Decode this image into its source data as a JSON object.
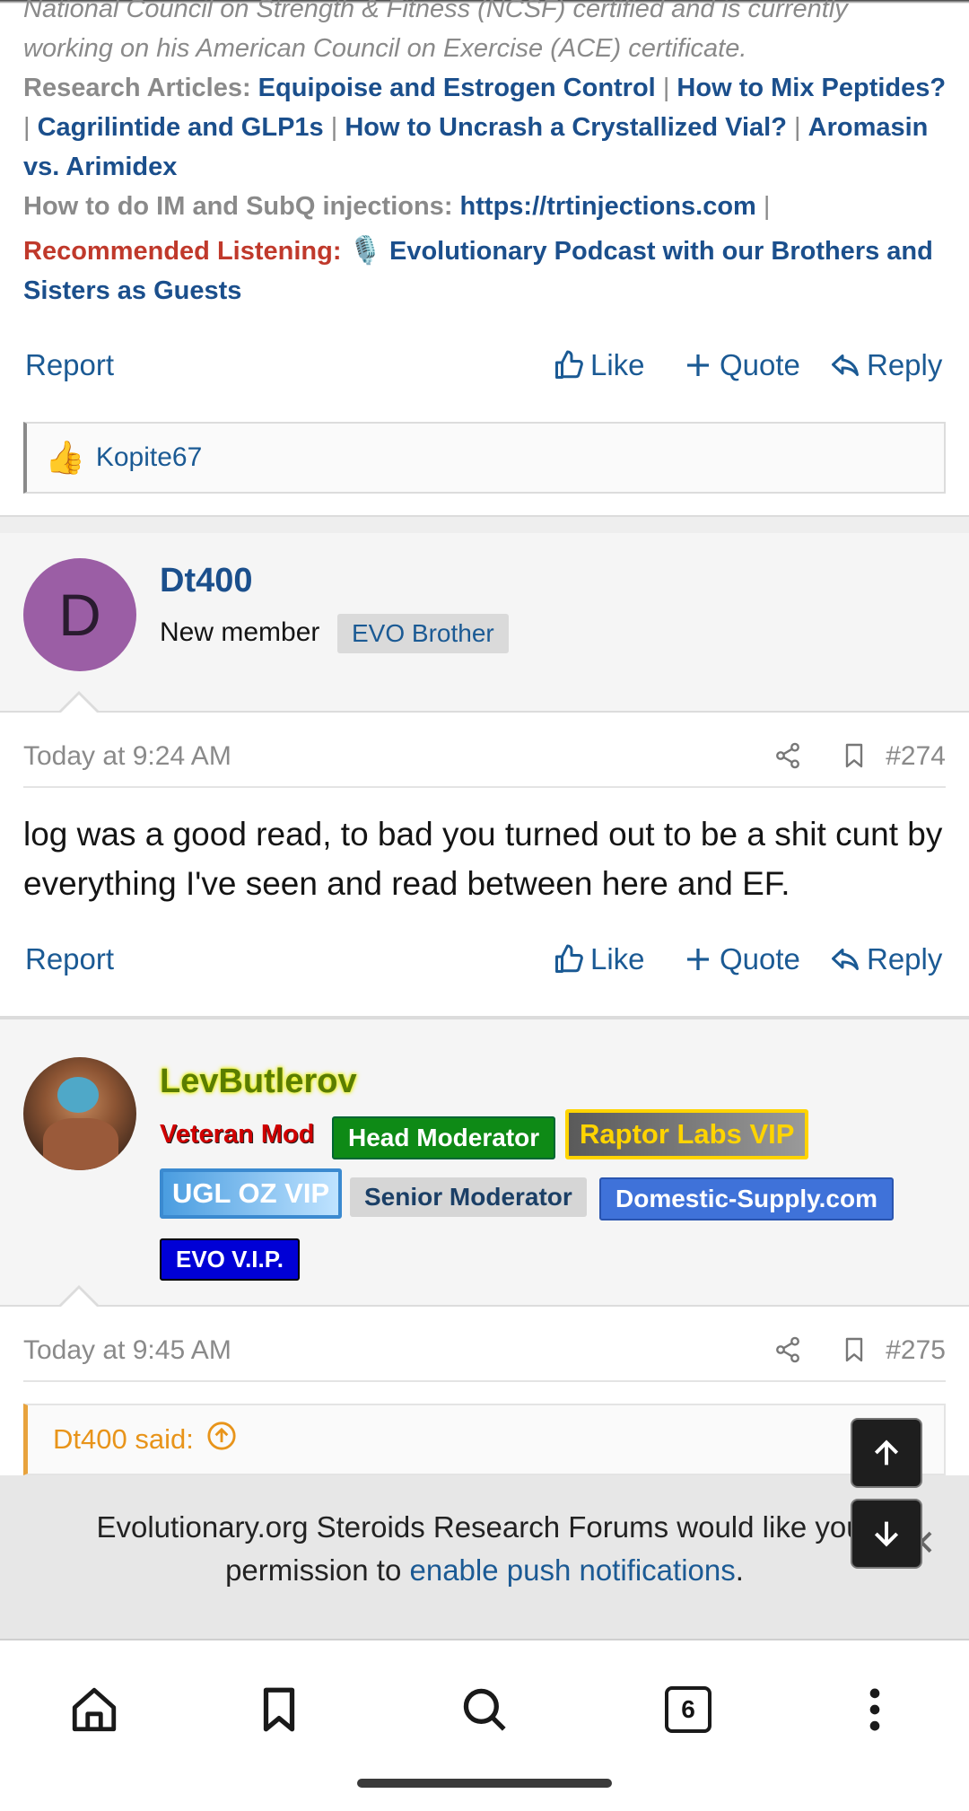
{
  "signature": {
    "line1": "National Council on Strength & Fitness (NCSF) certified and is currently",
    "line2": "working on his American Council on Exercise (ACE) certificate.",
    "research_label": "Research Articles:",
    "research_links": [
      "Equipoise and Estrogen Control",
      "How to Mix Peptides?",
      "Cagrilintide and GLP1s",
      "How to Uncrash a Crystallized Vial?",
      "Aromasin vs. Arimidex"
    ],
    "injections_label": "How to do IM and SubQ injections:",
    "injections_link": "https://trtinjections.com",
    "listening_label": "Recommended Listening:",
    "listening_link_line1": "Evolutionary Podcast with our Brothers and",
    "listening_link_line2": "Sisters as Guests",
    "separator": "|"
  },
  "post_actions": {
    "report": "Report",
    "like": "Like",
    "quote": "Quote",
    "reply": "Reply"
  },
  "reactions": {
    "users": "Kopite67"
  },
  "post274": {
    "avatar_letter": "D",
    "username": "Dt400",
    "user_title": "New member",
    "badge": "EVO Brother",
    "time": "Today at 9:24 AM",
    "number": "#274",
    "body": "log was a good read, to bad you turned out to be a shit cunt by everything I've seen and read between here and EF."
  },
  "post275": {
    "username": "LevButlerov",
    "title": "Veteran Mod",
    "badges": [
      "Head Moderator",
      "Raptor Labs VIP",
      "UGL OZ VIP",
      "Senior Moderator",
      "Domestic-Supply.com",
      "EVO V.I.P."
    ],
    "time": "Today at 9:45 AM",
    "number": "#275",
    "quote_author": "Dt400 said:"
  },
  "notification": {
    "text_before": "Evolutionary.org Steroids Research Forums would like your",
    "text_mid": "permission to ",
    "link": "enable push notifications",
    "text_after": "."
  },
  "bottom_nav": {
    "tab_count": "6"
  },
  "colors": {
    "link": "#1b4f8c",
    "accent": "#1b5a94",
    "quote_orange": "#e8941a",
    "recommended_red": "#c0392b"
  }
}
